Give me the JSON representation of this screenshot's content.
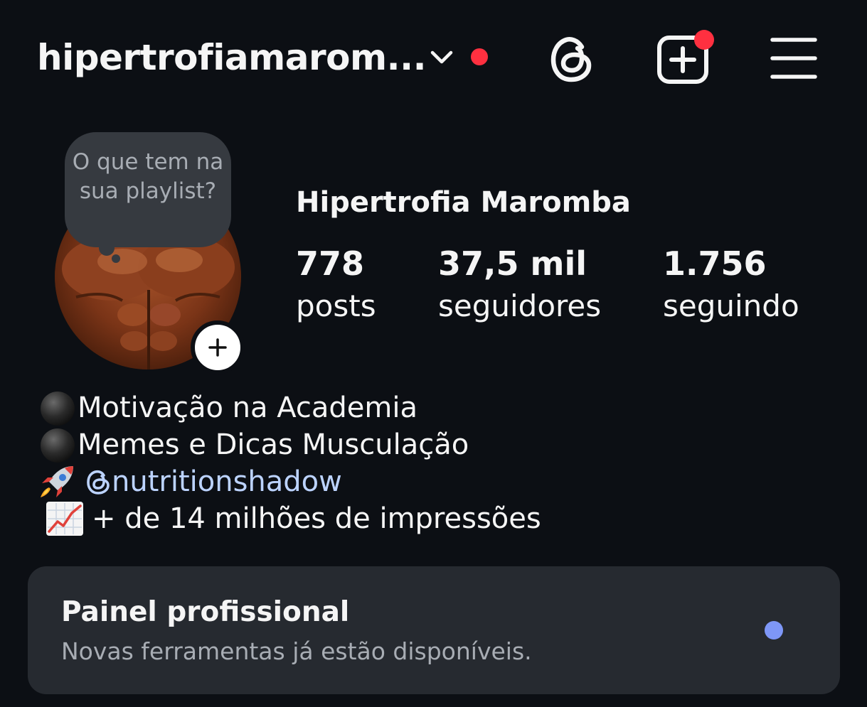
{
  "header": {
    "username": "hipertrofiamarom...",
    "icons": [
      "chevron-down-icon",
      "threads-icon",
      "create-post-icon",
      "menu-icon"
    ],
    "notification_color": "#ff3040"
  },
  "note": {
    "text": "O que tem na sua playlist?"
  },
  "profile": {
    "display_name": "Hipertrofia Maromba",
    "stats": {
      "posts": {
        "value": "778",
        "label": "posts"
      },
      "followers": {
        "value": "37,5 mil",
        "label": "seguidores"
      },
      "following": {
        "value": "1.756",
        "label": "seguindo"
      }
    }
  },
  "bio": {
    "line1": "Motivação na Academia",
    "line2": "Memes e Dicas Musculação",
    "line3_handle": "nutritionshadow",
    "line4": "+ de 14 milhões de impressões",
    "emoji_icons": [
      "black-circle-icon",
      "black-circle-icon",
      "rocket-icon",
      "chart-increasing-icon"
    ],
    "link_color": "#bcd3ff"
  },
  "dashboard": {
    "title": "Painel profissional",
    "subtitle": "Novas ferramentas já estão disponíveis.",
    "indicator_color": "#7e97f7"
  }
}
